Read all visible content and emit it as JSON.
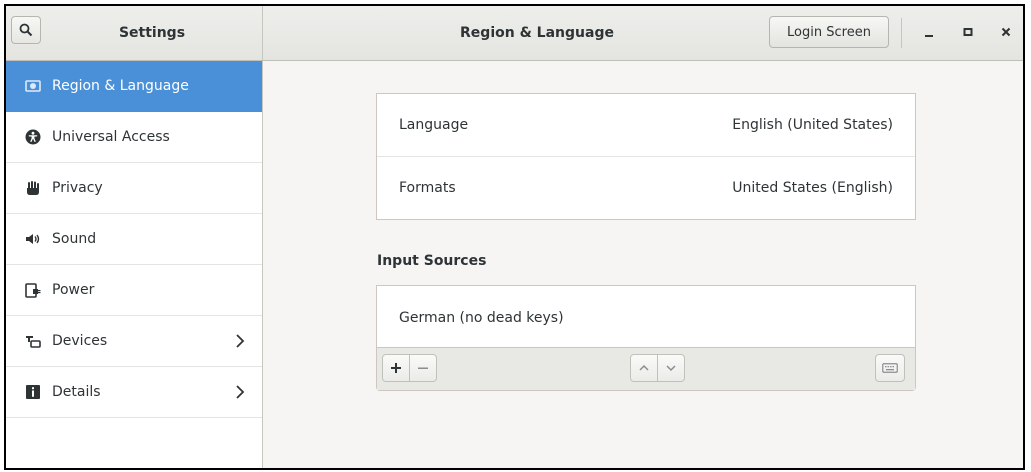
{
  "window": {
    "app_title": "Settings",
    "panel_title": "Region & Language",
    "login_button": "Login Screen",
    "controls": {
      "minimize_icon": "minimize-icon",
      "maximize_icon": "maximize-icon",
      "close_icon": "close-icon"
    }
  },
  "sidebar": {
    "items": [
      {
        "label": "Region & Language",
        "icon": "region-icon",
        "active": true
      },
      {
        "label": "Universal Access",
        "icon": "accessibility-icon"
      },
      {
        "label": "Privacy",
        "icon": "privacy-hand-icon"
      },
      {
        "label": "Sound",
        "icon": "speaker-icon"
      },
      {
        "label": "Power",
        "icon": "power-plug-icon"
      },
      {
        "label": "Devices",
        "icon": "devices-icon",
        "has_chevron": true
      },
      {
        "label": "Details",
        "icon": "info-icon",
        "has_chevron": true
      }
    ]
  },
  "region": {
    "language_label": "Language",
    "language_value": "English (United States)",
    "formats_label": "Formats",
    "formats_value": "United States (English)"
  },
  "input_sources": {
    "title": "Input Sources",
    "items": [
      "German (no dead keys)"
    ],
    "toolbar": {
      "add_icon": "plus-icon",
      "remove_icon": "minus-icon",
      "up_icon": "chevron-up-icon",
      "down_icon": "chevron-down-icon",
      "keyboard_icon": "keyboard-icon"
    }
  },
  "colors": {
    "accent": "#4a90d9",
    "content_bg": "#f6f5f4",
    "header_bg": "#e8e8e7"
  }
}
